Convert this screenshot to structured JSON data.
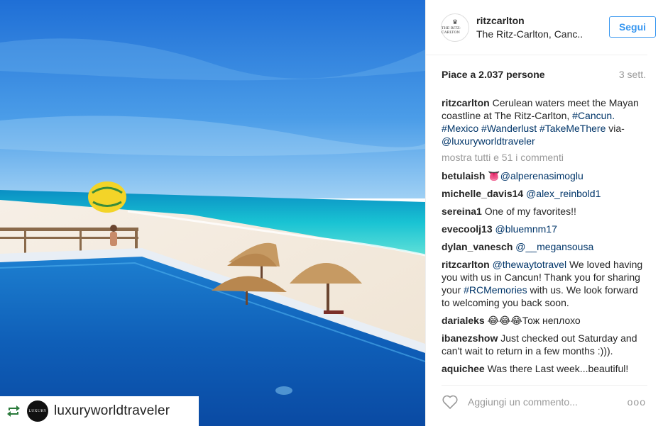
{
  "repost": {
    "username": "luxuryworldtraveler",
    "avatar_text": "LUXURY"
  },
  "header": {
    "username": "ritzcarlton",
    "location": "The Ritz-Carlton, Canc..",
    "follow_label": "Segui",
    "avatar_text": "THE RITZ-CARLTON"
  },
  "stats": {
    "likes": "Piace a 2.037 persone",
    "time": "3 sett."
  },
  "caption": {
    "user": "ritzcarlton",
    "text": "Cerulean waters meet the Mayan coastline at The Ritz-Carlton,",
    "tag1": "#Cancun.",
    "tag2": "#Mexico",
    "tag3": "#Wanderlust",
    "tag4": "#TakeMeThere",
    "via": "via-",
    "mention": "@luxuryworldtraveler"
  },
  "show_all": "mostra tutti e 51 i commenti",
  "comments": [
    {
      "user": "betulaish",
      "emoji": "👅",
      "mention": "@alperenasimoglu"
    },
    {
      "user": "michelle_davis14",
      "mention": "@alex_reinbold1"
    },
    {
      "user": "sereina1",
      "text": "One of my favorites!!"
    },
    {
      "user": "evecoolj13",
      "mention": "@bluemnm17"
    },
    {
      "user": "dylan_vanesch",
      "mention": "@__megansousa"
    },
    {
      "user": "ritzcarlton",
      "mention": "@thewaytotravel",
      "text_a": "We loved having you with us in Cancun! Thank you for sharing your",
      "tag": "#RCMemories",
      "text_b": "with us. We look forward to welcoming you back soon."
    },
    {
      "user": "darialeks",
      "emoji": "😂😂😂",
      "text": "Тож неплохо"
    },
    {
      "user": "ibanezshow",
      "text": "Just checked out Saturday and can't wait to return in a few months :)))."
    },
    {
      "user": "aquichee",
      "text": "Was there Last week...beautiful!"
    }
  ],
  "footer": {
    "comment_placeholder": "Aggiungi un commento...",
    "more_label": "ooo"
  },
  "icons": {
    "repost": "repost-icon",
    "like": "heart-icon",
    "more": "more-options-icon"
  },
  "colors": {
    "link": "#003569",
    "follow": "#3897f0",
    "muted": "#999999"
  }
}
